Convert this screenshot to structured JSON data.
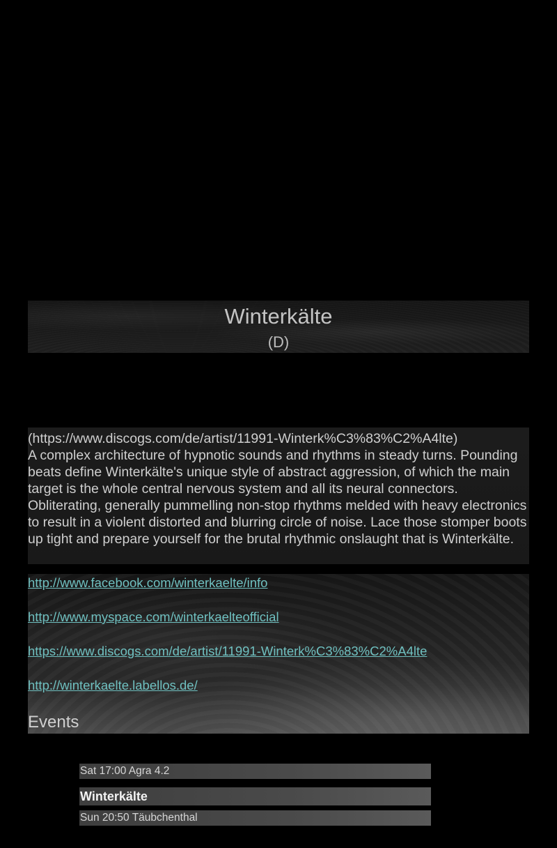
{
  "artist": {
    "name": "Winterkälte",
    "country": "(D)"
  },
  "description": {
    "source": "(https://www.discogs.com/de/artist/11991-Winterk%C3%83%C2%A4lte)",
    "text": "A complex architecture of hypnotic sounds and rhythms in steady turns. Pounding beats define Winterkälte's unique style of abstract aggression, of which the main target is the whole central nervous system and all its neural connectors. Obliterating, generally pummelling non-stop rhythms melded with heavy electronics to result in a violent distorted and blurring circle of noise. Lace those stomper boots up tight and prepare yourself for the brutal rhythmic onslaught that is Winterkälte."
  },
  "links": [
    "http://www.facebook.com/winterkaelte/info",
    "http://www.myspace.com/winterkaelteofficial",
    "https://www.discogs.com/de/artist/11991-Winterk%C3%83%C2%A4lte",
    "http://winterkaelte.labellos.de/"
  ],
  "events": {
    "heading": "Events",
    "previous": "Sat 17:00 Agra 4.2",
    "current": "Winterkälte",
    "next": "Sun 20:50 Täubchenthal"
  },
  "colors": {
    "background": "#000000",
    "link": "#6fc0c0",
    "text": "#c8c8c8"
  }
}
